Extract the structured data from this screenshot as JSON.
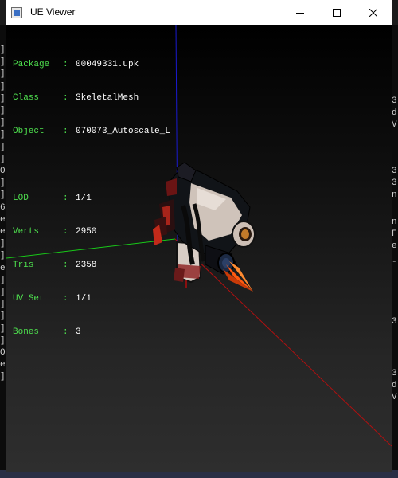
{
  "window": {
    "title": "UE Viewer",
    "icons": {
      "app": "ue-viewer-app-icon",
      "minimize": "minimize-icon",
      "maximize": "maximize-icon",
      "close": "close-icon"
    }
  },
  "info_panel": {
    "package": {
      "label": "Package",
      "value": "00049331.upk"
    },
    "class": {
      "label": "Class",
      "value": "SkeletalMesh"
    },
    "object": {
      "label": "Object",
      "value": "070073_Autoscale_L"
    },
    "lod": {
      "label": "LOD",
      "value": "1/1"
    },
    "verts": {
      "label": "Verts",
      "value": "2950"
    },
    "tris": {
      "label": "Tris",
      "value": "2358"
    },
    "uvset": {
      "label": "UV Set",
      "value": "1/1"
    },
    "bones": {
      "label": "Bones",
      "value": "3"
    },
    "separator": ":"
  },
  "scene": {
    "axis_colors": {
      "x": "#b01010",
      "y": "#18c818",
      "z": "#1a1ad0"
    }
  },
  "background_console": {
    "left_chars": [
      "]",
      "]",
      "]",
      "]",
      "]",
      "]",
      "]",
      "]",
      "]",
      "]",
      "O",
      "]",
      "]",
      "6",
      "e",
      "e",
      "]",
      "]",
      "e",
      "]",
      "]",
      "]",
      "]",
      "]",
      "]",
      "O",
      "e",
      "]"
    ],
    "right_chars": [
      "3",
      "d",
      "V",
      "3",
      "3",
      "n",
      "n",
      "F",
      "e",
      "-",
      "3",
      "3",
      "d",
      "V"
    ]
  }
}
